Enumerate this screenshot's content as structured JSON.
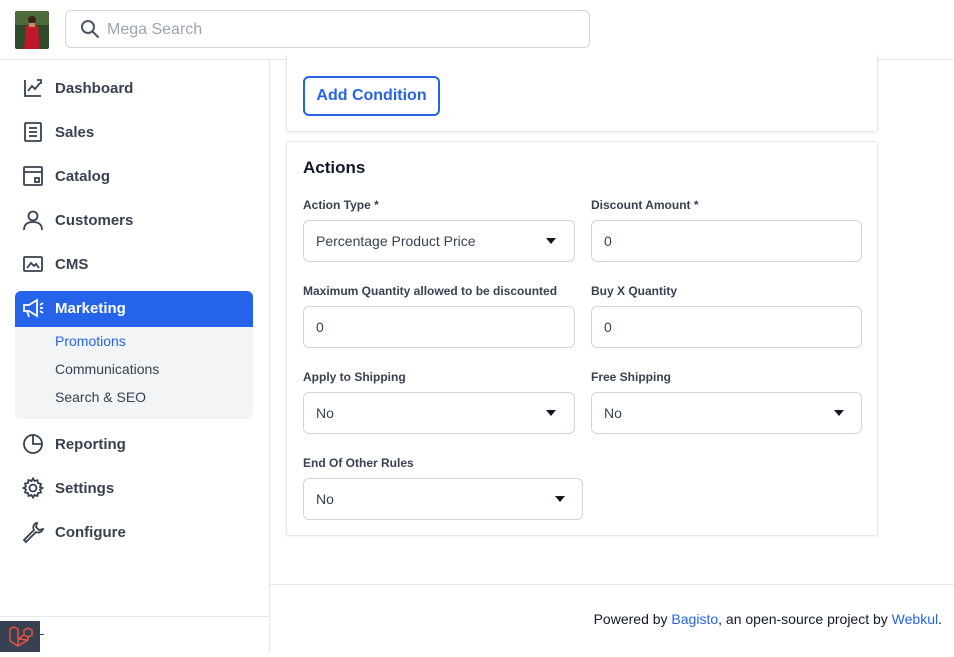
{
  "search": {
    "placeholder": "Mega Search"
  },
  "sidebar": {
    "items": [
      {
        "label": "Dashboard",
        "icon": "dashboard-icon"
      },
      {
        "label": "Sales",
        "icon": "sales-icon"
      },
      {
        "label": "Catalog",
        "icon": "catalog-icon"
      },
      {
        "label": "Customers",
        "icon": "customers-icon"
      },
      {
        "label": "CMS",
        "icon": "cms-icon"
      },
      {
        "label": "Marketing",
        "icon": "megaphone-icon",
        "active": true
      },
      {
        "label": "Reporting",
        "icon": "pie-chart-icon"
      },
      {
        "label": "Settings",
        "icon": "gear-icon"
      },
      {
        "label": "Configure",
        "icon": "wrench-icon"
      }
    ],
    "marketing_submenu": [
      {
        "label": "Promotions",
        "active": true
      },
      {
        "label": "Communications"
      },
      {
        "label": "Search & SEO"
      }
    ]
  },
  "conditions": {
    "add_button": "Add Condition"
  },
  "actions": {
    "title": "Actions",
    "fields": {
      "action_type": {
        "label": "Action Type *",
        "value": "Percentage Product Price"
      },
      "discount_amount": {
        "label": "Discount Amount *",
        "value": "0"
      },
      "max_qty": {
        "label": "Maximum Quantity allowed to be discounted",
        "value": "0"
      },
      "buy_x_qty": {
        "label": "Buy X Quantity",
        "value": "0"
      },
      "apply_shipping": {
        "label": "Apply to Shipping",
        "value": "No"
      },
      "free_shipping": {
        "label": "Free Shipping",
        "value": "No"
      },
      "end_other_rules": {
        "label": "End Of Other Rules",
        "value": "No"
      }
    }
  },
  "footer": {
    "prefix": "Powered by ",
    "bagisto": "Bagisto",
    "middle": ", an open-source project by ",
    "webkul": "Webkul",
    "suffix": "."
  },
  "colors": {
    "accent": "#2563eb",
    "sidebar_active": "#2563eb",
    "submenu_bg": "#f3f4f6"
  }
}
